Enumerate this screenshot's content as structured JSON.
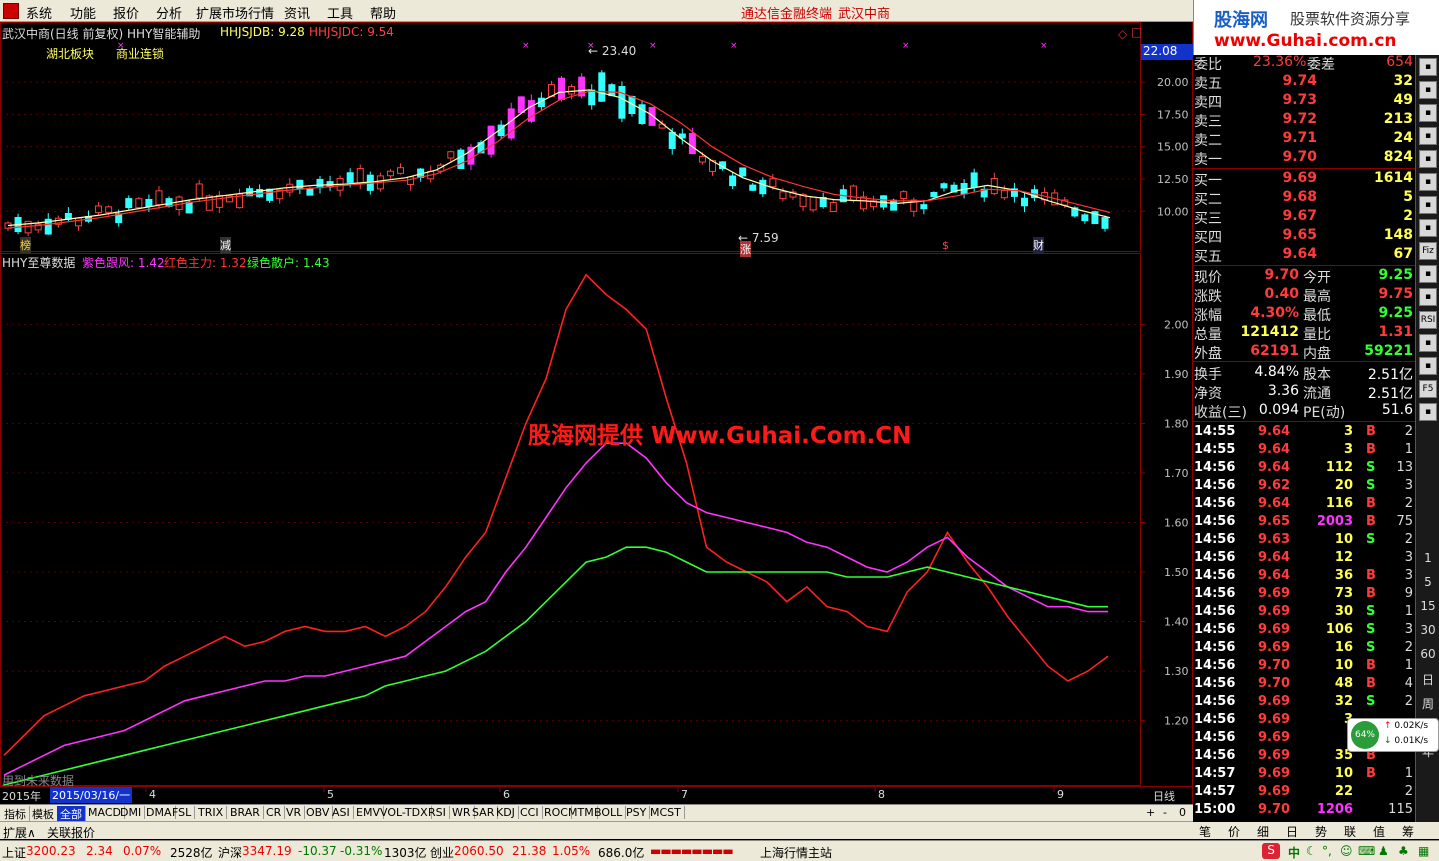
{
  "menu": {
    "items": [
      "系统",
      "功能",
      "报价",
      "分析",
      "扩展市场行情",
      "资讯",
      "工具",
      "帮助"
    ],
    "center_title": [
      "通达信金融终端",
      "武汉中商"
    ]
  },
  "brand": {
    "logo": "股海网",
    "slogan": "股票软件资源分享",
    "url": "www.Guhai.com.cn"
  },
  "kline": {
    "title": "武汉中商(日线 前复权) HHY智能辅助",
    "ind1_label": "HHJSJDB: 9.28",
    "ind2_label": "HHJSJDC: 9.54",
    "sector1": "湖北板块",
    "sector2": "商业连锁",
    "price_tag": "22.08",
    "high_label": "23.40",
    "low_label": "7.59",
    "y_ticks": [
      "20.00",
      "17.50",
      "15.00",
      "12.50",
      "10.00"
    ],
    "markers": [
      "榜",
      "减",
      "涨",
      "$",
      "财"
    ]
  },
  "indicator": {
    "title": "HHY至尊数据",
    "purple_label": "紫色跟风: 1.42",
    "red_label": "红色主力: 1.32",
    "green_label": "绿色散户: 1.43",
    "y_ticks": [
      "2.00",
      "1.90",
      "1.80",
      "1.70",
      "1.60",
      "1.50",
      "1.40",
      "1.30",
      "1.20"
    ],
    "future_note": "用到未来数据"
  },
  "timeaxis": {
    "year": "2015年",
    "date": "2015/03/16/一",
    "months": [
      "4",
      "5",
      "6",
      "7",
      "8",
      "9"
    ],
    "period": "日线"
  },
  "watermark": "股海网提供 Www.Guhai.Com.CN",
  "quote": {
    "header_left": "委比",
    "header_mid": "23.36%",
    "header_right_label": "委差",
    "header_right": "654",
    "asks": [
      {
        "label": "卖五",
        "price": "9.74",
        "vol": "32"
      },
      {
        "label": "卖四",
        "price": "9.73",
        "vol": "49"
      },
      {
        "label": "卖三",
        "price": "9.72",
        "vol": "213"
      },
      {
        "label": "卖二",
        "price": "9.71",
        "vol": "24"
      },
      {
        "label": "卖一",
        "price": "9.70",
        "vol": "824"
      }
    ],
    "bids": [
      {
        "label": "买一",
        "price": "9.69",
        "vol": "1614"
      },
      {
        "label": "买二",
        "price": "9.68",
        "vol": "5"
      },
      {
        "label": "买三",
        "price": "9.67",
        "vol": "2"
      },
      {
        "label": "买四",
        "price": "9.65",
        "vol": "148"
      },
      {
        "label": "买五",
        "price": "9.64",
        "vol": "67"
      }
    ],
    "stats": [
      {
        "l1": "现价",
        "v1": "9.70",
        "c1": "up",
        "l2": "今开",
        "v2": "9.25",
        "c2": "dn"
      },
      {
        "l1": "涨跌",
        "v1": "0.40",
        "c1": "up",
        "l2": "最高",
        "v2": "9.75",
        "c2": "up"
      },
      {
        "l1": "涨幅",
        "v1": "4.30%",
        "c1": "up",
        "l2": "最低",
        "v2": "9.25",
        "c2": "dn"
      },
      {
        "l1": "总量",
        "v1": "121412",
        "c1": "yl",
        "l2": "量比",
        "v2": "1.31",
        "c2": "up"
      },
      {
        "l1": "外盘",
        "v1": "62191",
        "c1": "up",
        "l2": "内盘",
        "v2": "59221",
        "c2": "dn"
      }
    ],
    "fund": [
      {
        "l1": "换手",
        "v1": "4.84%",
        "l2": "股本",
        "v2": "2.51亿"
      },
      {
        "l1": "净资",
        "v1": "3.36",
        "l2": "流通",
        "v2": "2.51亿"
      },
      {
        "l1": "收益(三)",
        "v1": "0.094",
        "l2": "PE(动)",
        "v2": "51.6"
      }
    ],
    "ticks": [
      {
        "t": "14:55",
        "p": "9.64",
        "v": "3",
        "s": "B",
        "n": "2"
      },
      {
        "t": "14:55",
        "p": "9.64",
        "v": "3",
        "s": "B",
        "n": "1"
      },
      {
        "t": "14:56",
        "p": "9.64",
        "v": "112",
        "s": "S",
        "n": "13"
      },
      {
        "t": "14:56",
        "p": "9.62",
        "v": "20",
        "s": "S",
        "n": "3"
      },
      {
        "t": "14:56",
        "p": "9.64",
        "v": "116",
        "s": "B",
        "n": "2"
      },
      {
        "t": "14:56",
        "p": "9.65",
        "v": "2003",
        "s": "B",
        "n": "75"
      },
      {
        "t": "14:56",
        "p": "9.63",
        "v": "10",
        "s": "S",
        "n": "2"
      },
      {
        "t": "14:56",
        "p": "9.64",
        "v": "12",
        "s": "",
        "n": "3"
      },
      {
        "t": "14:56",
        "p": "9.64",
        "v": "36",
        "s": "B",
        "n": "3"
      },
      {
        "t": "14:56",
        "p": "9.69",
        "v": "73",
        "s": "B",
        "n": "9"
      },
      {
        "t": "14:56",
        "p": "9.69",
        "v": "30",
        "s": "S",
        "n": "1"
      },
      {
        "t": "14:56",
        "p": "9.69",
        "v": "106",
        "s": "S",
        "n": "3"
      },
      {
        "t": "14:56",
        "p": "9.69",
        "v": "16",
        "s": "S",
        "n": "2"
      },
      {
        "t": "14:56",
        "p": "9.70",
        "v": "10",
        "s": "B",
        "n": "1"
      },
      {
        "t": "14:56",
        "p": "9.70",
        "v": "48",
        "s": "B",
        "n": "4"
      },
      {
        "t": "14:56",
        "p": "9.69",
        "v": "32",
        "s": "S",
        "n": "2"
      },
      {
        "t": "14:56",
        "p": "9.69",
        "v": "3",
        "s": "",
        "n": ""
      },
      {
        "t": "14:56",
        "p": "9.69",
        "v": "",
        "s": "",
        "n": ""
      },
      {
        "t": "14:56",
        "p": "9.69",
        "v": "35",
        "s": "B",
        "n": ""
      },
      {
        "t": "14:57",
        "p": "9.69",
        "v": "10",
        "s": "B",
        "n": "1"
      },
      {
        "t": "14:57",
        "p": "9.69",
        "v": "22",
        "s": "",
        "n": "2"
      },
      {
        "t": "15:00",
        "p": "9.70",
        "v": "1206",
        "s": "",
        "n": "115"
      }
    ]
  },
  "sidetools": {
    "icons": [
      "gear-icon",
      "tool-icon",
      "window-icon",
      "list-icon",
      "bars-icon",
      "candles-icon",
      "chart-icon",
      "lines-icon",
      "fiz-icon",
      "grid-icon",
      "cost-icon",
      "rsi-icon",
      "dot-icon",
      "diamond-icon",
      "f5-icon",
      "bars2-icon"
    ],
    "labels": [
      "Fiz",
      "RSI",
      "F5"
    ],
    "periods": [
      "1",
      "5",
      "15",
      "30",
      "60",
      "日",
      "周",
      "月",
      "年"
    ]
  },
  "gauge": {
    "percent": "64%",
    "up": "0.02K/s",
    "down": "0.01K/s"
  },
  "tabs": [
    "指标",
    "模板",
    "全部",
    "MACD",
    "DMI",
    "DMA",
    "FSL",
    "TRIX",
    "BRAR",
    "CR",
    "VR",
    "OBV",
    "ASI",
    "EMV",
    "VOL-TDX",
    "RSI",
    "WR",
    "SAR",
    "KDJ",
    "CCI",
    "ROC",
    "MTM",
    "BOLL",
    "PSY",
    "MCST"
  ],
  "ext": {
    "extend": "扩展∧",
    "related": "关联报价",
    "plus": "+",
    "minus": "-",
    "zero": "0"
  },
  "rtabs": [
    "笔",
    "价",
    "细",
    "日",
    "势",
    "联",
    "值",
    "筹"
  ],
  "status": {
    "sh_label": "上证",
    "sh_val": "3200.23",
    "sh_chg": "2.34",
    "sh_pct": "0.07%",
    "sh_amt": "2528亿",
    "sz_label": "沪深",
    "sz_val": "3347.19",
    "sz_chg": "-10.37",
    "sz_pct": "-0.31%",
    "sz_amt": "1303亿",
    "cy_label": "创业",
    "cy_val": "2060.50",
    "cy_chg": "21.38",
    "cy_pct": "1.05%",
    "cy_amt": "686.0亿",
    "server": "上海行情主站",
    "ime": "中"
  },
  "chart_data": [
    {
      "type": "candlestick",
      "title": "武汉中商(日线 前复权) HHY智能辅助",
      "ylim": [
        7.0,
        24.5
      ],
      "y_ticks": [
        10.0,
        12.5,
        15.0,
        17.5,
        20.0
      ],
      "series": [
        {
          "name": "HHJSJDB",
          "values": [
            8.9,
            9.1,
            9.4,
            9.7,
            10.1,
            10.5,
            10.9,
            11.2,
            11.5,
            11.8,
            12.0,
            12.1,
            12.3,
            12.6,
            13.2,
            14.5,
            16.2,
            18.0,
            19.2,
            19.4,
            18.8,
            17.5,
            15.6,
            13.9,
            12.6,
            11.8,
            11.2,
            10.9,
            10.8,
            10.6,
            10.8,
            11.6,
            12.0,
            11.6,
            10.8,
            10.1,
            9.5
          ]
        },
        {
          "name": "HHJSJDC",
          "values": [
            8.7,
            8.9,
            9.2,
            9.5,
            9.9,
            10.3,
            10.7,
            11.0,
            11.3,
            11.6,
            11.8,
            12.0,
            12.2,
            12.4,
            12.9,
            13.9,
            15.4,
            17.2,
            18.6,
            19.3,
            19.2,
            18.3,
            16.8,
            15.0,
            13.6,
            12.6,
            11.9,
            11.3,
            11.0,
            10.8,
            10.8,
            11.2,
            11.7,
            11.6,
            11.1,
            10.5,
            9.9
          ]
        }
      ],
      "extremes": {
        "high": 23.4,
        "low": 7.59
      }
    },
    {
      "type": "line",
      "title": "HHY至尊数据",
      "ylim": [
        1.07,
        2.14
      ],
      "y_ticks": [
        1.2,
        1.3,
        1.4,
        1.5,
        1.6,
        1.7,
        1.8,
        1.9,
        2.0
      ],
      "series": [
        {
          "name": "红色主力",
          "values": [
            1.13,
            1.17,
            1.21,
            1.23,
            1.25,
            1.26,
            1.27,
            1.28,
            1.31,
            1.33,
            1.35,
            1.37,
            1.35,
            1.36,
            1.38,
            1.39,
            1.38,
            1.38,
            1.39,
            1.37,
            1.39,
            1.42,
            1.47,
            1.53,
            1.58,
            1.69,
            1.8,
            1.89,
            2.03,
            2.1,
            2.06,
            2.03,
            1.99,
            1.85,
            1.72,
            1.55,
            1.52,
            1.5,
            1.48,
            1.44,
            1.47,
            1.43,
            1.42,
            1.39,
            1.38,
            1.46,
            1.5,
            1.58,
            1.52,
            1.47,
            1.41,
            1.36,
            1.31,
            1.28,
            1.3,
            1.33
          ]
        },
        {
          "name": "紫色跟风",
          "values": [
            1.09,
            1.11,
            1.13,
            1.15,
            1.16,
            1.17,
            1.18,
            1.2,
            1.22,
            1.24,
            1.25,
            1.26,
            1.27,
            1.28,
            1.28,
            1.29,
            1.29,
            1.3,
            1.31,
            1.32,
            1.33,
            1.36,
            1.39,
            1.42,
            1.44,
            1.5,
            1.55,
            1.61,
            1.67,
            1.72,
            1.76,
            1.76,
            1.73,
            1.68,
            1.64,
            1.62,
            1.61,
            1.6,
            1.59,
            1.58,
            1.56,
            1.55,
            1.53,
            1.51,
            1.5,
            1.52,
            1.55,
            1.57,
            1.53,
            1.5,
            1.47,
            1.45,
            1.43,
            1.43,
            1.42,
            1.42
          ]
        },
        {
          "name": "绿色散户",
          "values": [
            1.07,
            1.08,
            1.09,
            1.1,
            1.11,
            1.12,
            1.13,
            1.14,
            1.15,
            1.16,
            1.17,
            1.18,
            1.19,
            1.2,
            1.21,
            1.22,
            1.23,
            1.24,
            1.25,
            1.27,
            1.28,
            1.29,
            1.3,
            1.32,
            1.34,
            1.37,
            1.4,
            1.44,
            1.48,
            1.52,
            1.53,
            1.55,
            1.55,
            1.54,
            1.52,
            1.5,
            1.5,
            1.5,
            1.5,
            1.5,
            1.5,
            1.5,
            1.49,
            1.49,
            1.49,
            1.5,
            1.51,
            1.5,
            1.49,
            1.48,
            1.47,
            1.46,
            1.45,
            1.44,
            1.43,
            1.43
          ]
        }
      ]
    }
  ]
}
